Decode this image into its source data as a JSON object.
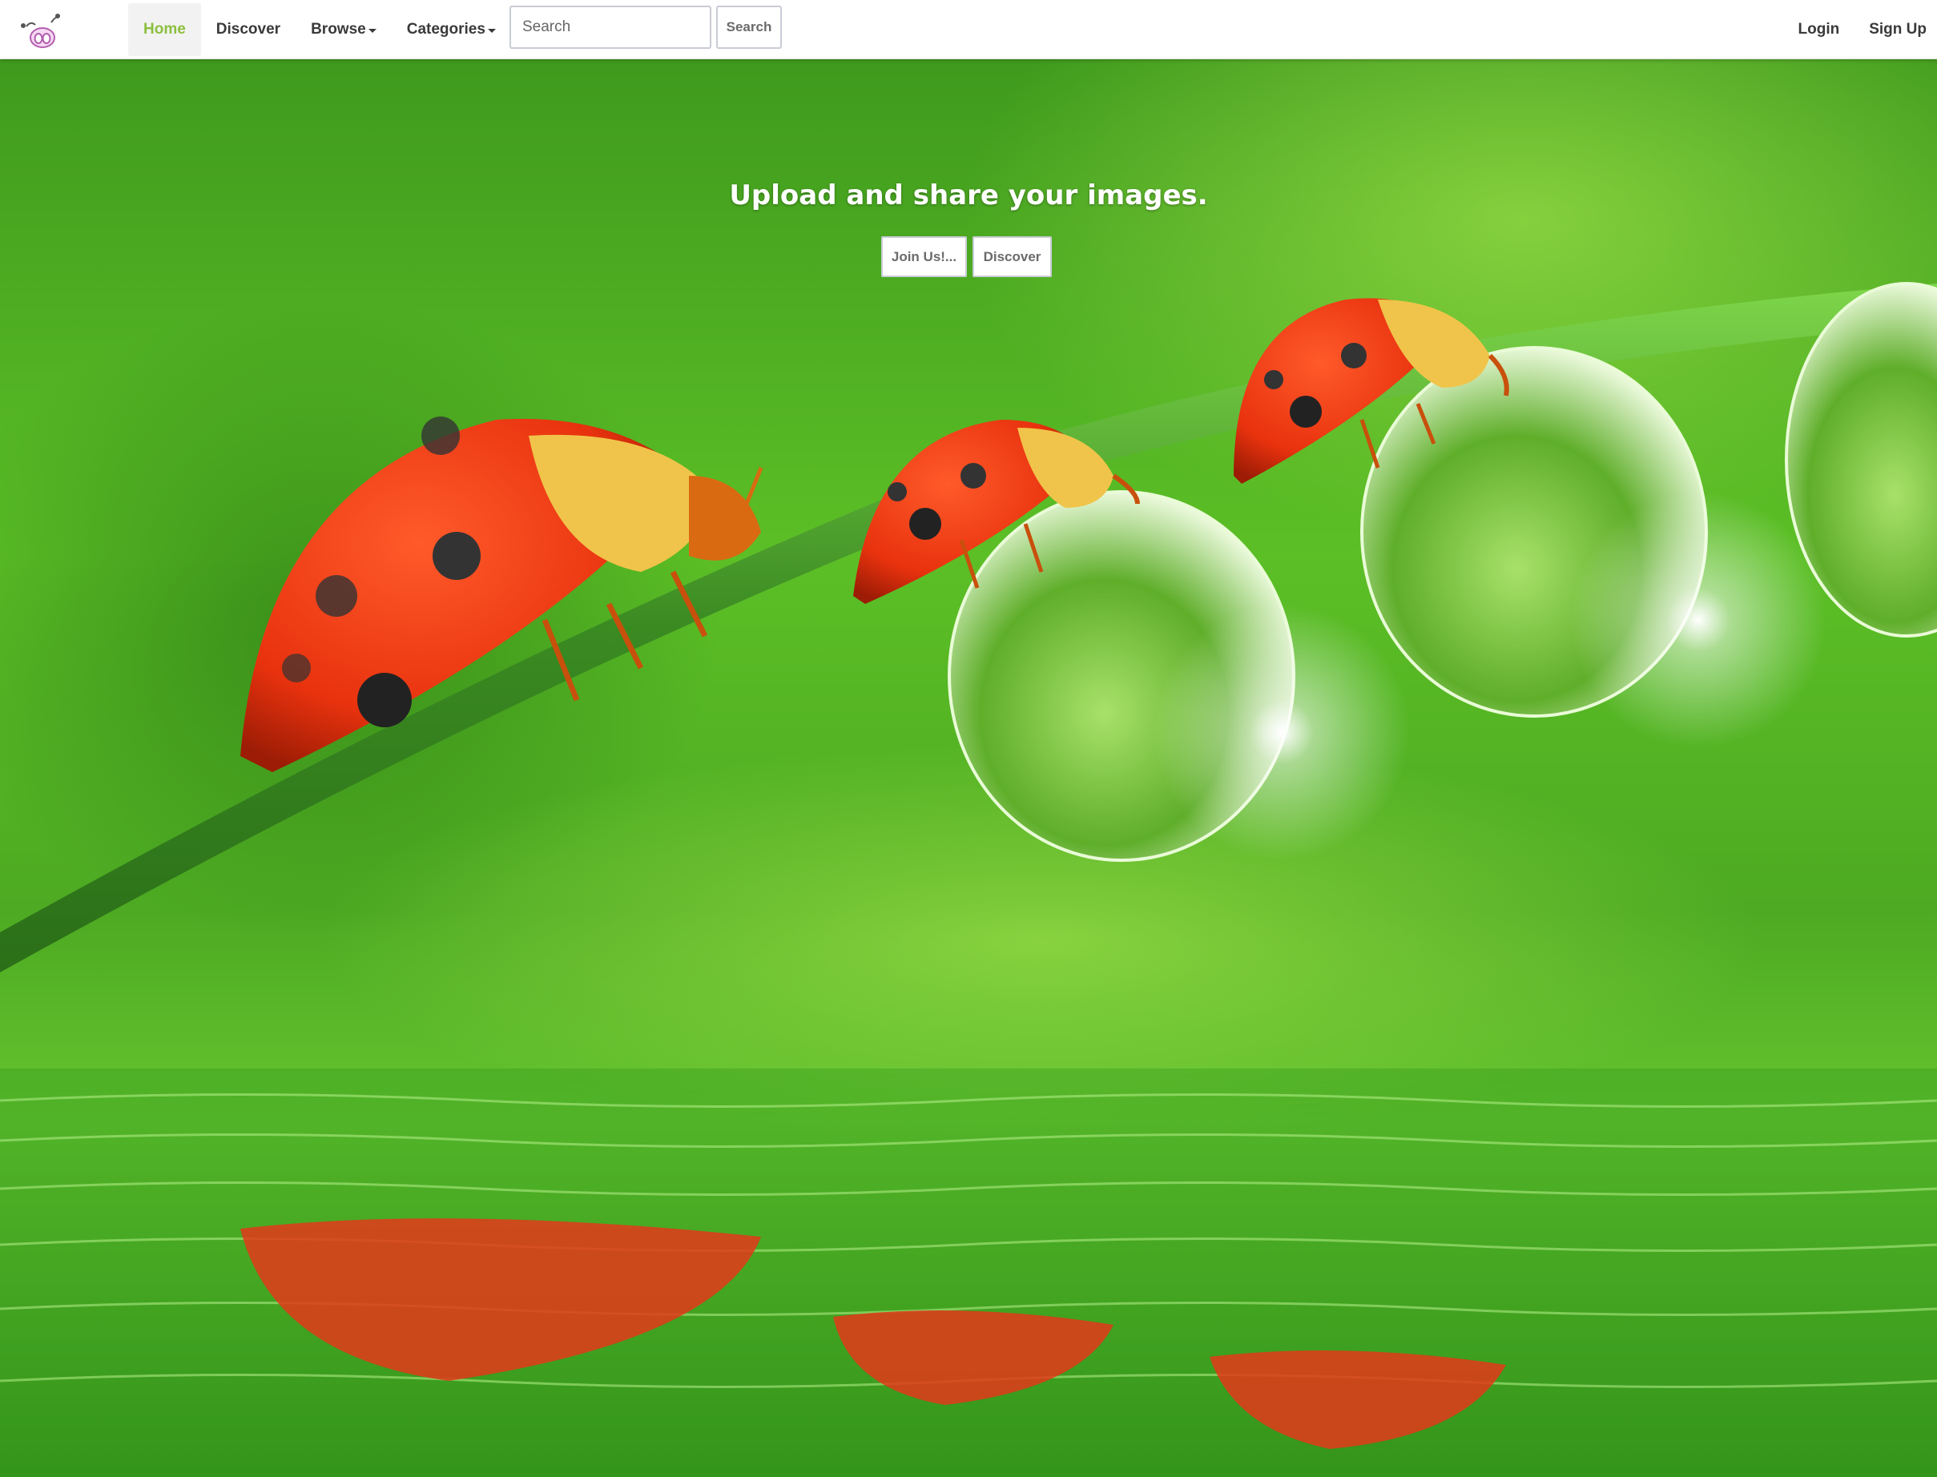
{
  "navbar": {
    "logo_icon": "mascot-logo-icon",
    "items": [
      {
        "label": "Home",
        "active": true
      },
      {
        "label": "Discover"
      },
      {
        "label": "Browse",
        "dropdown": true
      },
      {
        "label": "Categories",
        "dropdown": true
      }
    ],
    "search": {
      "placeholder": "Search",
      "value": "",
      "button_label": "Search"
    },
    "right_items": [
      {
        "label": "Login"
      },
      {
        "label": "Sign Up"
      }
    ]
  },
  "hero": {
    "headline": "Upload and share your images.",
    "buttons": [
      {
        "label": "Join Us!..."
      },
      {
        "label": "Discover"
      }
    ],
    "background_image": "ladybugs-on-grass-stem-with-dew-drops-photo"
  },
  "colors": {
    "active_nav": "#8cbf3f",
    "nav_text": "#3a3a3a",
    "button_border": "#c9ccd6",
    "hero_green": "#5fb82a"
  }
}
